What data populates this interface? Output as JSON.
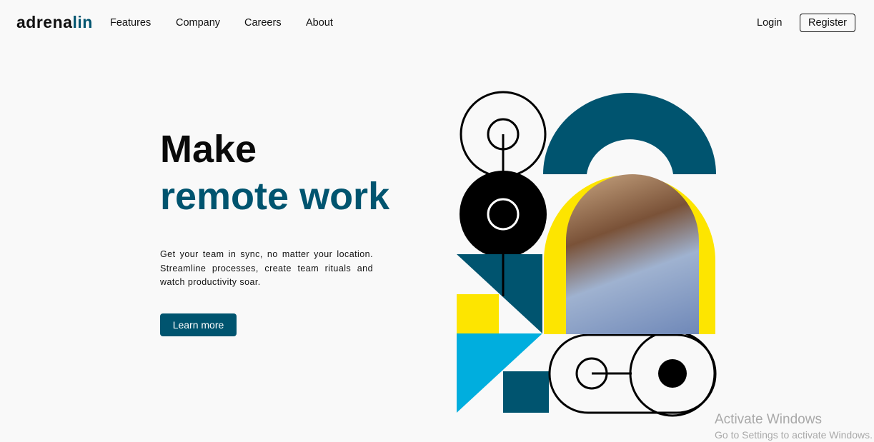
{
  "brand": {
    "name_part1": "adrena",
    "name_part2": "lin",
    "accent_color": "#00546f"
  },
  "nav": {
    "links": [
      "Features",
      "Company",
      "Careers",
      "About"
    ],
    "login_label": "Login",
    "register_label": "Register"
  },
  "hero": {
    "title_line1": "Make",
    "title_line2": "remote work",
    "description": "Get your team in sync, no matter your location. Streamline processes, create team rituals and watch productivity soar.",
    "cta_label": "Learn more"
  },
  "illustration": {
    "colors": {
      "teal": "#00546f",
      "yellow": "#fde500",
      "light_blue": "#00aede",
      "black": "#000000"
    }
  },
  "watermark": {
    "title": "Activate Windows",
    "subtitle": "Go to Settings to activate Windows."
  }
}
